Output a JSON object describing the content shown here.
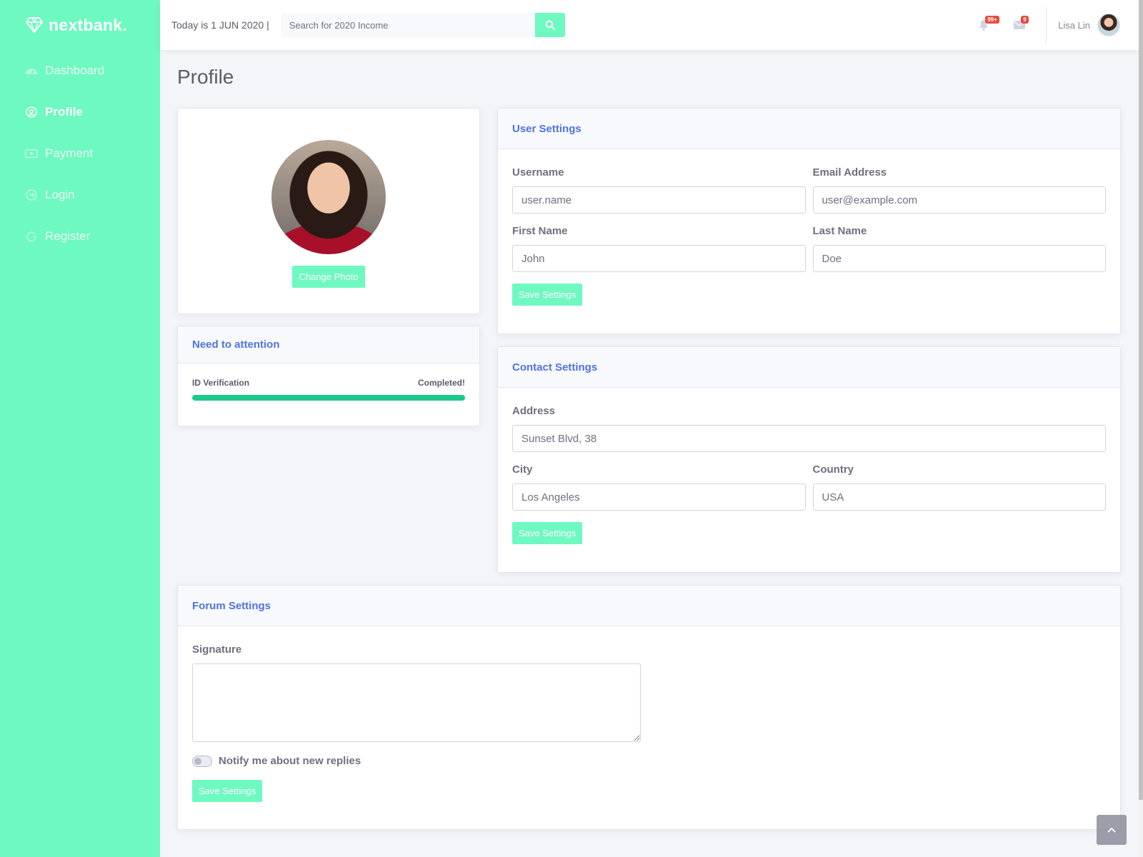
{
  "brand": {
    "name": "nextbank.",
    "icon": "diamond-icon"
  },
  "sidebar": {
    "items": [
      {
        "label": "Dashboard",
        "icon": "gauge-icon",
        "active": false
      },
      {
        "label": "Profile",
        "icon": "profile-icon",
        "active": true
      },
      {
        "label": "Payment",
        "icon": "money-icon",
        "active": false
      },
      {
        "label": "Login",
        "icon": "login-icon",
        "active": false
      },
      {
        "label": "Register",
        "icon": "register-icon",
        "active": false
      }
    ]
  },
  "topbar": {
    "today": "Today is 1 JUN 2020 |",
    "search_placeholder": "Search for 2020 Income",
    "alerts_count": "99+",
    "messages_count": "9",
    "user_name": "Lisa Lin"
  },
  "page": {
    "title": "Profile"
  },
  "photo_card": {
    "button": "Change Photo"
  },
  "attention": {
    "title": "Need to attention",
    "item_label": "ID Verification",
    "item_status": "Completed!",
    "progress": 1.0
  },
  "user_settings": {
    "title": "User Settings",
    "username_label": "Username",
    "username_value": "user.name",
    "email_label": "Email Address",
    "email_value": "user@example.com",
    "first_name_label": "First Name",
    "first_name_value": "John",
    "last_name_label": "Last Name",
    "last_name_value": "Doe",
    "save": "Save Settings"
  },
  "contact_settings": {
    "title": "Contact Settings",
    "address_label": "Address",
    "address_value": "Sunset Blvd, 38",
    "city_label": "City",
    "city_value": "Los Angeles",
    "country_label": "Country",
    "country_value": "USA",
    "save": "Save Settings"
  },
  "forum_settings": {
    "title": "Forum Settings",
    "signature_label": "Signature",
    "signature_value": "",
    "notify_label": "Notify me about new replies",
    "notify_on": false,
    "save": "Save Settings"
  },
  "colors": {
    "accent": "#6ef9c0",
    "header_text": "#4e73df",
    "progress": "#1cc88a",
    "badge": "#e74a3b"
  }
}
